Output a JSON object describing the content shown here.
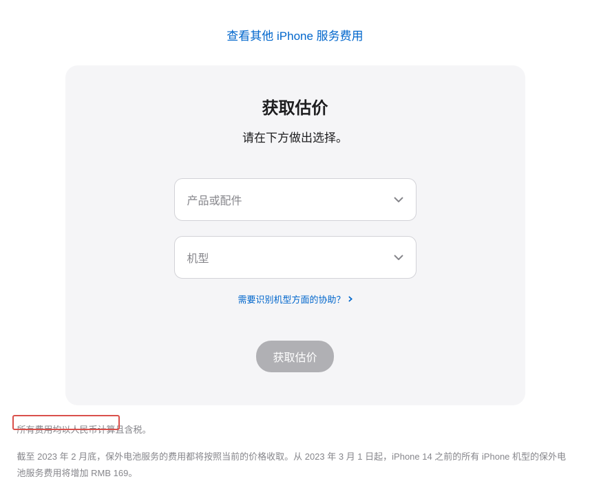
{
  "topLink": {
    "label": "查看其他 iPhone 服务费用"
  },
  "card": {
    "title": "获取估价",
    "subtitle": "请在下方做出选择。",
    "selectProduct": {
      "placeholder": "产品或配件"
    },
    "selectModel": {
      "placeholder": "机型"
    },
    "helpLink": {
      "label": "需要识别机型方面的协助？"
    },
    "button": {
      "label": "获取估价"
    }
  },
  "footer": {
    "line1": "所有费用均以人民币计算且含税。",
    "line2_part1": "截至 2023 年 2 月底，保外电池服务的费用都将按照当前的价格收取。从 2023 年 3 月 1 日起，iPhone 14 之前的所有 iPhone 机型的保外电池服务",
    "line2_part2": "费用将增加 RMB 169。"
  }
}
